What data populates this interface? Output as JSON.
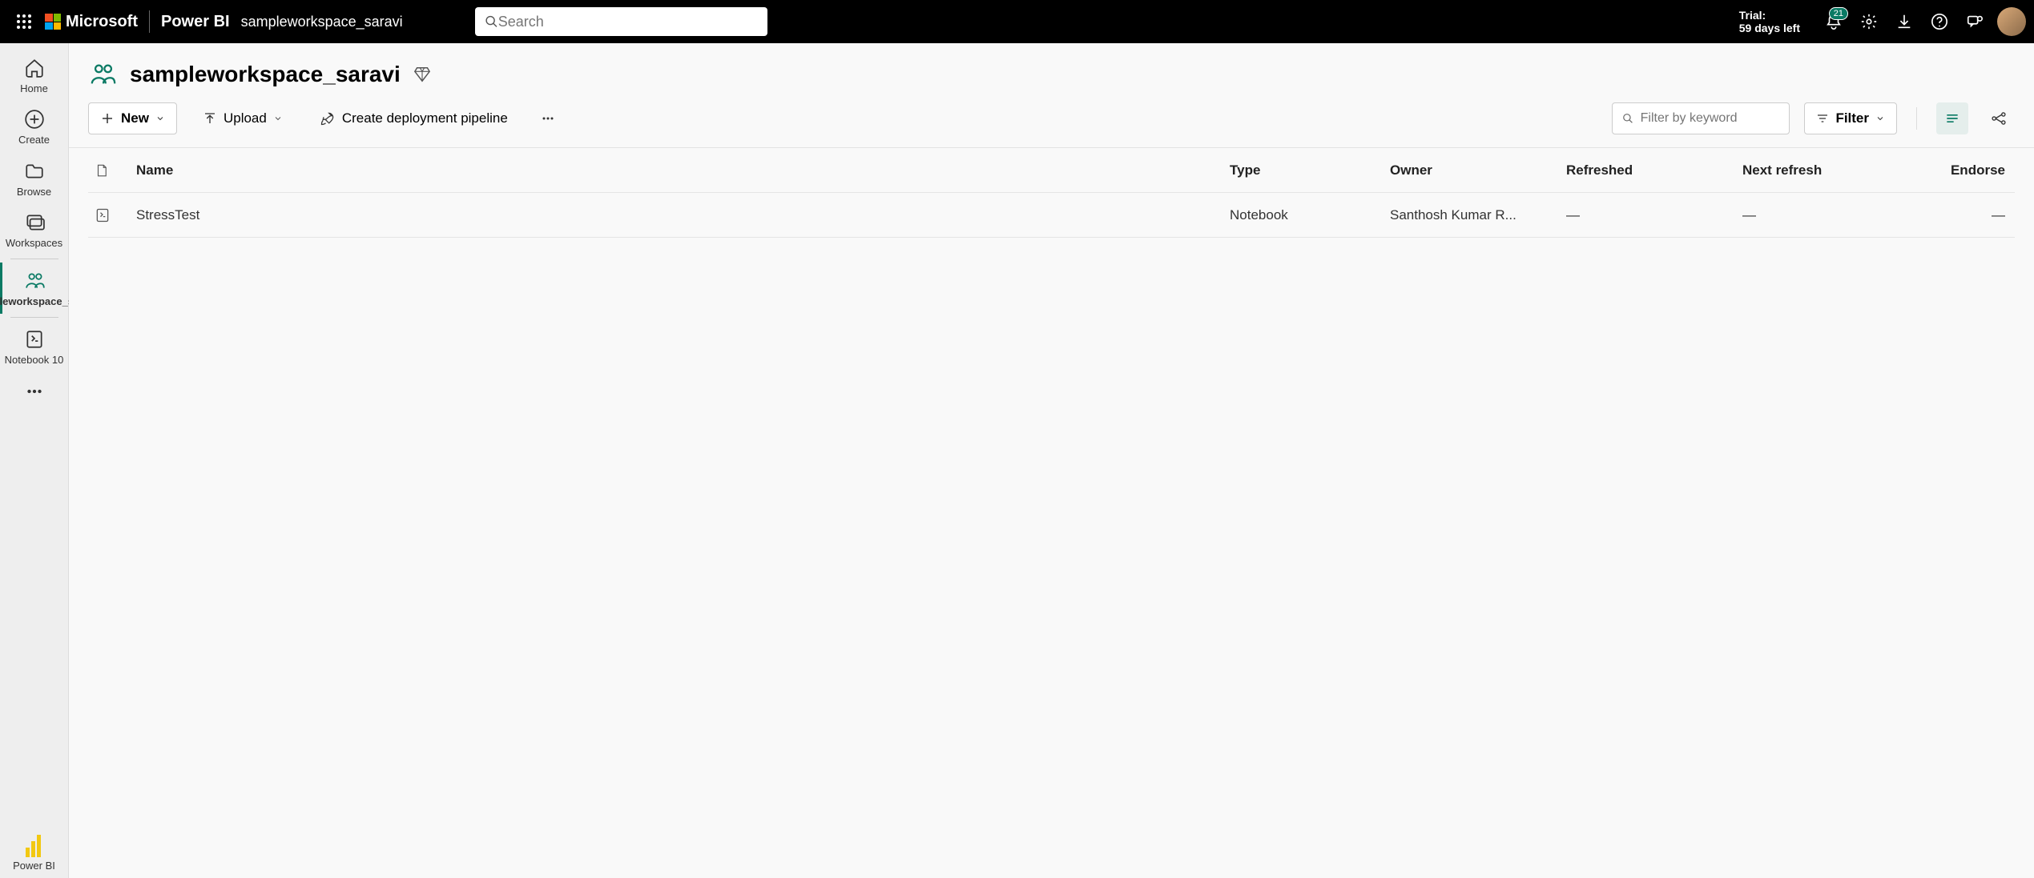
{
  "topbar": {
    "brand": "Microsoft",
    "app": "Power BI",
    "workspace_label": "sampleworkspace_saravi",
    "search_placeholder": "Search",
    "trial_line1": "Trial:",
    "trial_line2": "59 days left",
    "notification_count": "21"
  },
  "sidebar": {
    "home": "Home",
    "create": "Create",
    "browse": "Browse",
    "workspaces": "Workspaces",
    "current_workspace": "sampleworkspace_saravi",
    "notebook": "Notebook 10",
    "powerbi": "Power BI"
  },
  "page": {
    "title": "sampleworkspace_saravi"
  },
  "toolbar": {
    "new_label": "New",
    "upload_label": "Upload",
    "pipeline_label": "Create deployment pipeline",
    "filter_placeholder": "Filter by keyword",
    "filter_button": "Filter"
  },
  "table": {
    "headers": {
      "name": "Name",
      "type": "Type",
      "owner": "Owner",
      "refreshed": "Refreshed",
      "next_refresh": "Next refresh",
      "endorse": "Endorse"
    },
    "rows": [
      {
        "name": "StressTest",
        "type": "Notebook",
        "owner": "Santhosh Kumar R...",
        "refreshed": "—",
        "next_refresh": "—",
        "endorse": "—"
      }
    ]
  }
}
